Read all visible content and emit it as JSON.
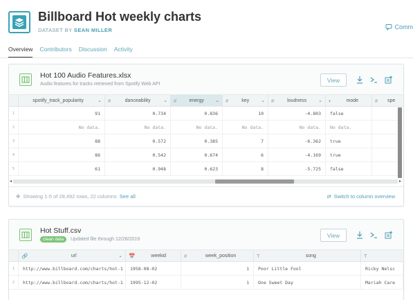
{
  "header": {
    "title": "Billboard Hot weekly charts",
    "byline_prefix": "DATASET BY",
    "author": "SEAN MILLER",
    "comment_label": "Comm"
  },
  "tabs": [
    {
      "label": "Overview",
      "active": true
    },
    {
      "label": "Contributors",
      "active": false
    },
    {
      "label": "Discussion",
      "active": false
    },
    {
      "label": "Activity",
      "active": false
    }
  ],
  "files": [
    {
      "name": "Hot 100 Audio Features.xlsx",
      "description": "Audio features for tracks retrieved from Spotify Web API",
      "view_label": "View",
      "columns": [
        {
          "name": "spotify_track_popularity",
          "type": ""
        },
        {
          "name": "danceability",
          "type": "#"
        },
        {
          "name": "energy",
          "type": "#"
        },
        {
          "name": "key",
          "type": "#"
        },
        {
          "name": "loudness",
          "type": "#"
        },
        {
          "name": "mode",
          "type": "◐"
        },
        {
          "name": "spe",
          "type": "#"
        }
      ],
      "rows": [
        {
          "n": "1",
          "pop": "91",
          "dance": "0.734",
          "energy": "0.836",
          "key": "10",
          "loud": "-4.803",
          "mode": "false"
        },
        {
          "n": "2",
          "pop": "No data.",
          "dance": "No data.",
          "energy": "No data.",
          "key": "No data.",
          "loud": "No data.",
          "mode": "No data."
        },
        {
          "n": "3",
          "pop": "88",
          "dance": "0.572",
          "energy": "0.385",
          "key": "7",
          "loud": "-6.362",
          "mode": "true"
        },
        {
          "n": "4",
          "pop": "86",
          "dance": "0.542",
          "energy": "0.674",
          "key": "6",
          "loud": "-4.169",
          "mode": "true"
        },
        {
          "n": "5",
          "pop": "61",
          "dance": "0.948",
          "energy": "0.623",
          "key": "8",
          "loud": "-5.725",
          "mode": "false"
        }
      ],
      "footer_text": "Showing 1-5 of 28,492 rows, 22 columns",
      "footer_link": "See all",
      "switch_label": "Switch to column overview"
    },
    {
      "name": "Hot Stuff.csv",
      "badge": "clean data",
      "updated": "Updated file through 12/28/2019",
      "view_label": "View",
      "columns": [
        {
          "name": "url",
          "type": "🔗"
        },
        {
          "name": "weekid",
          "type": "📅"
        },
        {
          "name": "week_position",
          "type": "#"
        },
        {
          "name": "song",
          "type": "T"
        },
        {
          "name": "",
          "type": "T"
        }
      ],
      "rows": [
        {
          "n": "1",
          "url": "http://www.billboard.com/charts/hot-1",
          "weekid": "1958-08-02",
          "pos": "1",
          "song": "Poor Little Fool",
          "performer": "Ricky Nelsc"
        },
        {
          "n": "2",
          "url": "http://www.billboard.com/charts/hot-1",
          "weekid": "1995-12-02",
          "pos": "1",
          "song": "One Sweet Day",
          "performer": "Mariah Care"
        }
      ]
    }
  ]
}
